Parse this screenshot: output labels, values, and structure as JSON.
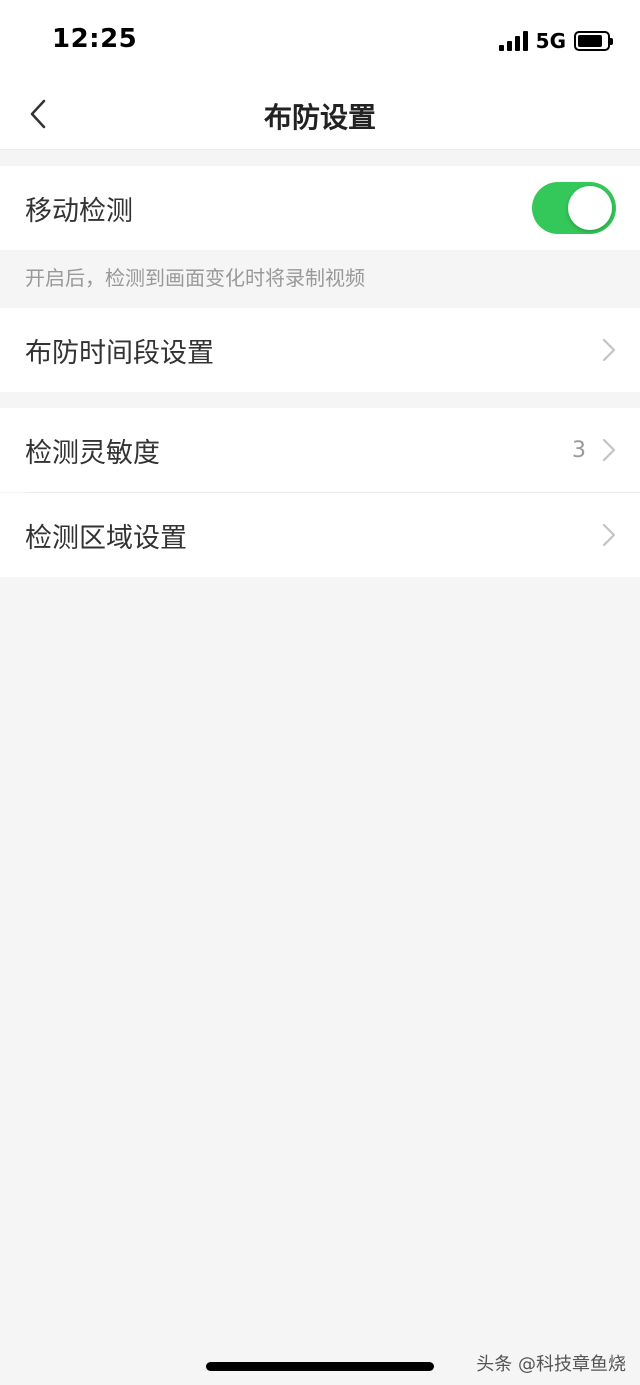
{
  "status_bar": {
    "time": "12:25",
    "network": "5G",
    "icons": [
      "signal-icon",
      "battery-icon"
    ]
  },
  "nav": {
    "title": "布防设置",
    "back_icon": "chevron-left-icon"
  },
  "motion_detection": {
    "label": "移动检测",
    "enabled": true,
    "toggle_color": "#34c759",
    "hint": "开启后，检测到画面变化时将录制视频"
  },
  "schedule": {
    "label": "布防时间段设置",
    "icon": "chevron-right-icon"
  },
  "sensitivity": {
    "label": "检测灵敏度",
    "value": "3",
    "icon": "chevron-right-icon"
  },
  "area": {
    "label": "检测区域设置",
    "icon": "chevron-right-icon"
  },
  "watermark": "头条 @科技章鱼烧"
}
